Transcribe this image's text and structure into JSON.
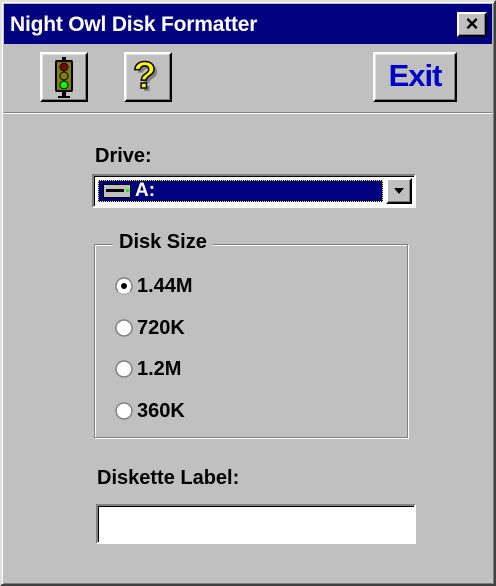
{
  "window": {
    "title": "Night Owl Disk Formatter",
    "close_label": "×"
  },
  "toolbar": {
    "start_icon": "traffic-light-icon",
    "help_icon": "question-mark-icon",
    "exit_label": "Exit"
  },
  "drive": {
    "label": "Drive:",
    "selected": "A:",
    "drive_icon": "floppy-drive-icon"
  },
  "disk_size": {
    "title": "Disk Size",
    "options": [
      {
        "label": "1.44M",
        "selected": true
      },
      {
        "label": "720K",
        "selected": false
      },
      {
        "label": "1.2M",
        "selected": false
      },
      {
        "label": "360K",
        "selected": false
      }
    ]
  },
  "diskette_label": {
    "label": "Diskette Label:",
    "value": ""
  },
  "colors": {
    "face": "#c0c0c0",
    "title_bar": "#000080",
    "selection": "#000080",
    "exit_text": "#0000c8"
  }
}
